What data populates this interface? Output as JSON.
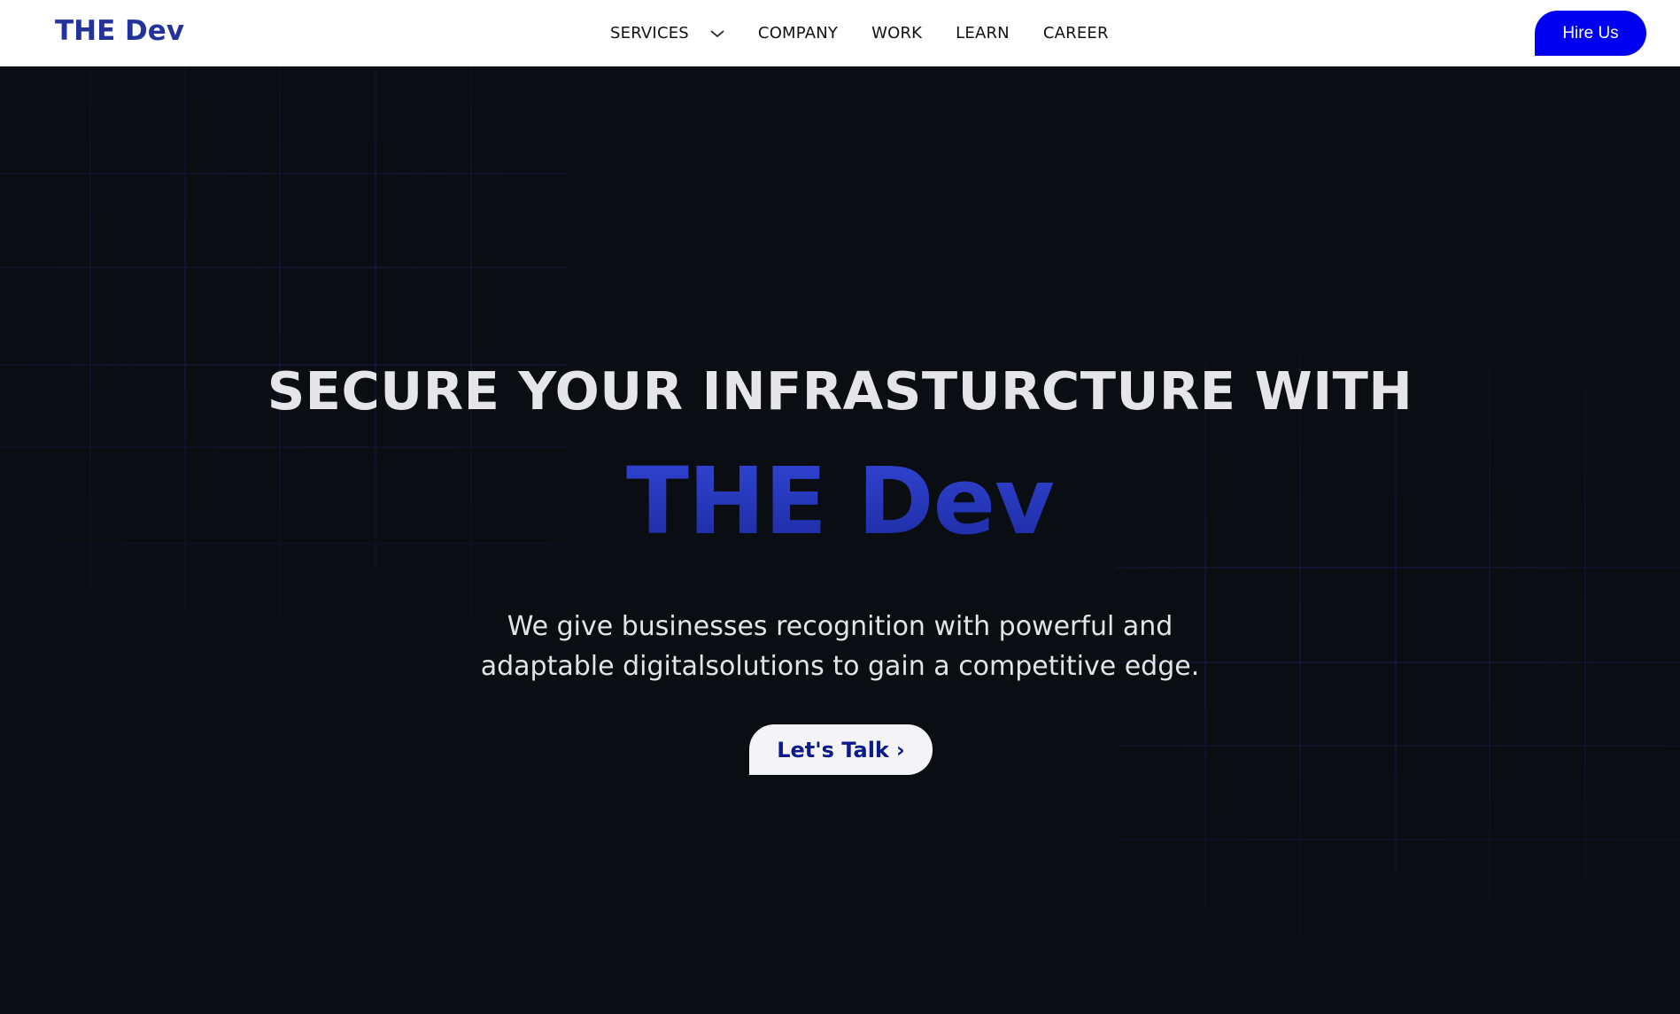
{
  "header": {
    "logo": "THE Dev",
    "nav": [
      {
        "label": "SERVICES",
        "has_dropdown": true
      },
      {
        "label": "COMPANY"
      },
      {
        "label": "WORK"
      },
      {
        "label": "LEARN"
      },
      {
        "label": "CAREER"
      }
    ],
    "hire_label": "Hire Us"
  },
  "hero": {
    "headline": "SECURE YOUR INFRASTURCTURE WITH",
    "brand": "THE Dev",
    "subtitle_line1": "We give businesses recognition with powerful and",
    "subtitle_line2": "adaptable digitalsolutions to gain a competitive edge.",
    "cta_label": "Let's Talk",
    "cta_icon": "chevron-right-icon"
  },
  "colors": {
    "brand_blue": "#23339c",
    "hire_button": "#0000f0",
    "hero_background": "#0a0d12",
    "grid_line": "#1a1f5c",
    "cta_text": "#0c1a8c"
  }
}
